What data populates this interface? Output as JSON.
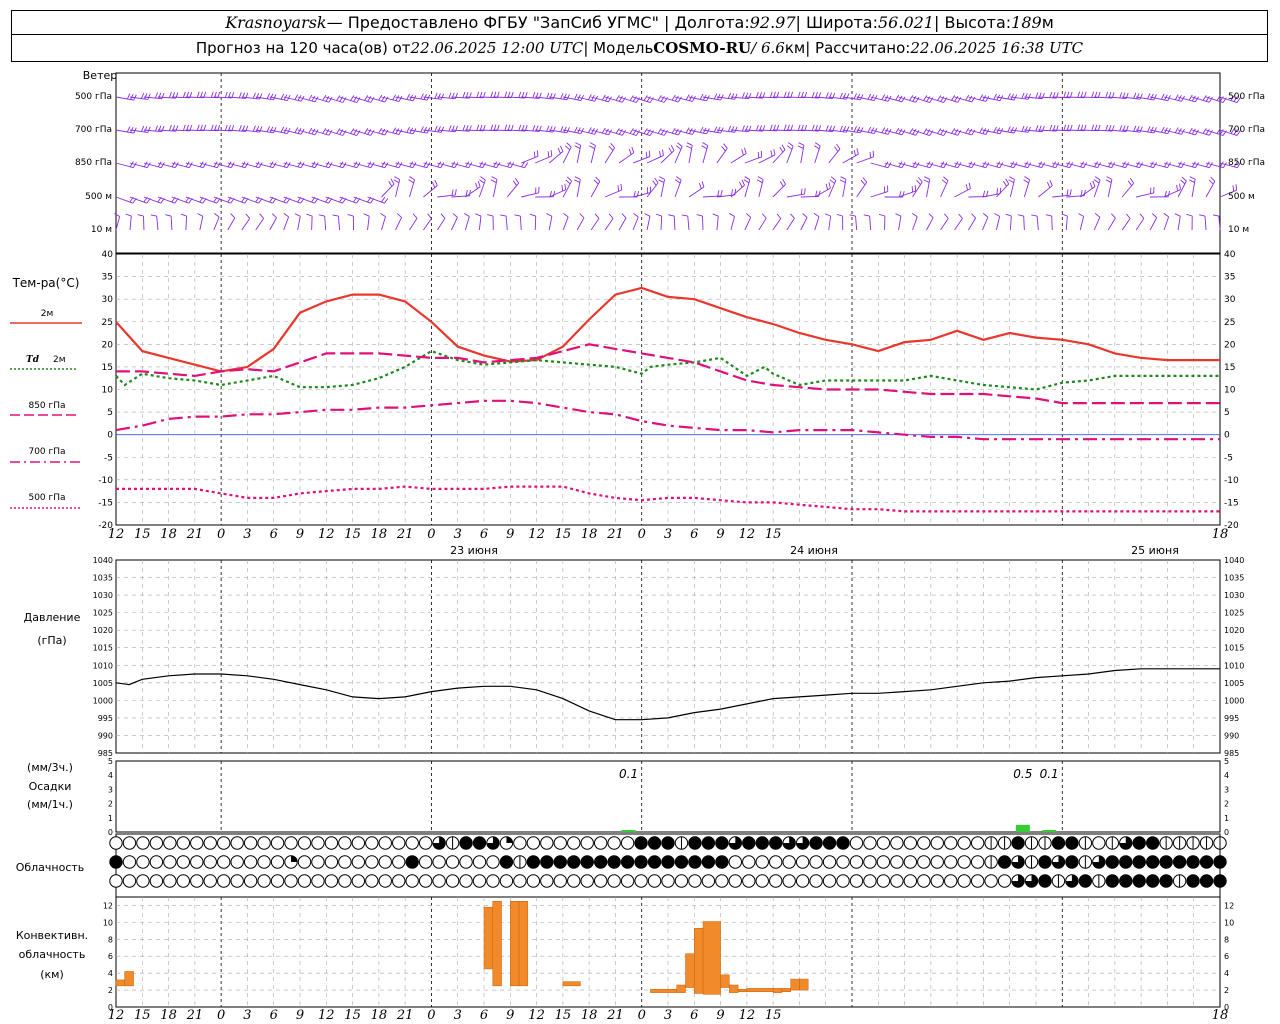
{
  "header": {
    "station": "Krasnoyarsk",
    "provider": " — Предоставлено ФГБУ \"ЗапСиб УГМС\" | Долгота: ",
    "lon": "92.97",
    "lat_label": " | Широта: ",
    "lat": "56.021",
    "alt_label": " | Высота: ",
    "alt": "189",
    "alt_unit": "м",
    "forecast_label": "Прогноз на 120 часа(ов) от ",
    "forecast_start": "22.06.2025 12:00 UTC",
    "model_label": " | Модель ",
    "model": "COSMO-RU",
    "resolution": " / 6.6",
    "res_unit": "км",
    "calc_label": " | Рассчитано: ",
    "calc_time": "22.06.2025 16:38 UTC"
  },
  "labels": {
    "wind_title": "Ветер",
    "wind_levels": [
      "500 гПа",
      "700 гПа",
      "850 гПа",
      "500 м",
      "10 м"
    ],
    "temp_title": "Тем-ра(°С)",
    "legend_2m": "2м",
    "legend_td": "Td",
    "legend_td_2m": "2м",
    "legend_850": "850 гПа",
    "legend_700": "700 гПа",
    "legend_500": "500 гПа",
    "pressure_title": "Давление",
    "pressure_unit": "(гПа)",
    "precip_unit3": "(мм/3ч.)",
    "precip_title": "Осадки",
    "precip_unit1": "(мм/1ч.)",
    "cloud_title": "Облачность",
    "conv_title1": "Конвективн.",
    "conv_title2": "облачность",
    "conv_unit": "(км)",
    "day1": "23 июня",
    "day2": "24 июня",
    "day3": "25 июня",
    "hour_ticks": [
      "12",
      "15",
      "18",
      "21",
      "0",
      "3",
      "6",
      "9",
      "12",
      "15",
      "18",
      "21",
      "0",
      "3",
      "6",
      "9",
      "12",
      "15",
      "18",
      "21",
      "0",
      "3",
      "6",
      "9",
      "12",
      "15",
      "18"
    ]
  },
  "chart_data": [
    {
      "type": "line",
      "title": "Тем-ра(°С)",
      "x_unit": "hours since 22.06 12 UTC",
      "ylim": [
        -20,
        40
      ],
      "series": [
        {
          "name": "2м",
          "color": "#e8382e",
          "style": "solid",
          "x": [
            0,
            3,
            6,
            9,
            12,
            15,
            18,
            21,
            24,
            27,
            30,
            33,
            36,
            39,
            42,
            45,
            48,
            51,
            54,
            57,
            60,
            63,
            66,
            69,
            72,
            75,
            78,
            81,
            84,
            87,
            90,
            93,
            96,
            99,
            102,
            105,
            108,
            111,
            114,
            117,
            120,
            123,
            126
          ],
          "values": [
            25,
            18.5,
            17,
            15.5,
            14,
            15,
            19,
            27,
            29.5,
            31,
            31,
            29.5,
            25,
            19.5,
            17.5,
            16.2,
            16.5,
            19.5,
            25.5,
            31,
            32.5,
            30.5,
            30,
            28,
            26,
            24.5,
            22.5,
            21,
            20,
            18.5,
            20.5,
            21,
            23,
            21,
            22.5,
            21.5,
            21,
            20,
            18,
            17,
            16.5,
            16.5,
            16.5
          ]
        },
        {
          "name": "Td 2м",
          "color": "#1e8a1e",
          "style": "dotted",
          "x": [
            0,
            1,
            3,
            6,
            9,
            12,
            15,
            18,
            21,
            24,
            27,
            30,
            33,
            36,
            39,
            42,
            45,
            48,
            51,
            54,
            57,
            60,
            61,
            63,
            66,
            69,
            72,
            74,
            75,
            78,
            81,
            84,
            87,
            90,
            93,
            96,
            99,
            102,
            105,
            108,
            111,
            114,
            117,
            120,
            123,
            126
          ],
          "values": [
            13,
            11,
            13.5,
            12.5,
            12,
            11,
            12,
            13,
            10.5,
            10.5,
            11,
            12.5,
            15,
            18.5,
            16.5,
            15.5,
            16,
            16.5,
            16,
            15.5,
            15,
            13.5,
            15,
            15.5,
            16,
            17,
            13,
            15,
            13.5,
            11,
            12,
            12,
            12,
            12,
            13,
            12,
            11,
            10.5,
            10,
            11.5,
            12,
            13,
            13,
            13,
            13,
            13
          ]
        },
        {
          "name": "850 гПа",
          "color": "#e0107a",
          "style": "dashed",
          "x": [
            0,
            3,
            6,
            9,
            12,
            15,
            18,
            21,
            24,
            27,
            30,
            33,
            36,
            39,
            42,
            45,
            48,
            51,
            54,
            57,
            60,
            63,
            66,
            69,
            72,
            75,
            78,
            81,
            84,
            87,
            90,
            93,
            96,
            99,
            102,
            105,
            108,
            111,
            114,
            117,
            120,
            123,
            126
          ],
          "values": [
            14,
            14,
            13.5,
            13,
            14,
            14.5,
            14,
            16,
            18,
            18,
            18,
            17.5,
            17,
            17,
            16,
            16.5,
            17,
            18.5,
            20,
            19,
            18,
            17,
            16,
            14,
            12,
            11,
            10.5,
            10,
            10,
            10,
            9.5,
            9,
            9,
            9,
            8.5,
            8,
            7,
            7,
            7,
            7,
            7,
            7,
            7
          ]
        },
        {
          "name": "700 гПа",
          "color": "#e0107a",
          "style": "dashdot",
          "x": [
            0,
            3,
            6,
            9,
            12,
            15,
            18,
            21,
            24,
            27,
            30,
            33,
            36,
            39,
            42,
            45,
            48,
            51,
            54,
            57,
            60,
            63,
            66,
            69,
            72,
            75,
            78,
            81,
            84,
            87,
            90,
            93,
            96,
            99,
            102,
            105,
            108,
            111,
            114,
            117,
            120,
            123,
            126
          ],
          "values": [
            1,
            2,
            3.5,
            4,
            4,
            4.5,
            4.5,
            5,
            5.5,
            5.5,
            6,
            6,
            6.5,
            7,
            7.5,
            7.5,
            7,
            6,
            5,
            4.5,
            3,
            2,
            1.5,
            1,
            1,
            0.5,
            1,
            1,
            1,
            0.5,
            0,
            -0.5,
            -0.5,
            -1,
            -1,
            -1,
            -1,
            -1,
            -1,
            -1,
            -1,
            -1,
            -1
          ]
        },
        {
          "name": "500 гПа",
          "color": "#e0107a",
          "style": "dotted",
          "x": [
            0,
            3,
            6,
            9,
            12,
            15,
            18,
            21,
            24,
            27,
            30,
            33,
            36,
            39,
            42,
            45,
            48,
            51,
            54,
            57,
            60,
            63,
            66,
            69,
            72,
            75,
            78,
            81,
            84,
            87,
            90,
            93,
            96,
            99,
            102,
            105,
            108,
            111,
            114,
            117,
            120,
            123,
            126
          ],
          "values": [
            -12,
            -12,
            -12,
            -12,
            -13,
            -14,
            -14,
            -13,
            -12.5,
            -12,
            -12,
            -11.5,
            -12,
            -12,
            -12,
            -11.5,
            -11.5,
            -11.5,
            -13,
            -14,
            -14.5,
            -14,
            -14,
            -14.5,
            -15,
            -15,
            -15.5,
            -16,
            -16.5,
            -16.5,
            -17,
            -17,
            -17,
            -17,
            -17,
            -17,
            -17,
            -17,
            -17,
            -17,
            -17,
            -17,
            -17
          ]
        }
      ]
    },
    {
      "type": "line",
      "title": "Давление",
      "ylabel": "(гПа)",
      "ylim": [
        985,
        1040
      ],
      "series": [
        {
          "name": "Давление",
          "color": "#000000",
          "x": [
            0,
            1.5,
            3,
            6,
            9,
            12,
            15,
            18,
            21,
            24,
            27,
            30,
            33,
            36,
            39,
            42,
            45,
            48,
            51,
            54,
            57,
            60,
            63,
            66,
            69,
            72,
            75,
            78,
            81,
            84,
            87,
            90,
            93,
            96,
            99,
            102,
            105,
            108,
            111,
            114,
            117,
            120,
            123,
            126
          ],
          "values": [
            1005,
            1004.5,
            1006,
            1007,
            1007.5,
            1007.5,
            1007,
            1006,
            1004.5,
            1003,
            1001,
            1000.5,
            1001,
            1002.5,
            1003.5,
            1004,
            1004,
            1003,
            1000.5,
            997,
            994.5,
            994.5,
            995,
            996.5,
            997.5,
            999,
            1000.5,
            1001,
            1001.5,
            1002,
            1002,
            1002.5,
            1003,
            1004,
            1005,
            1005.5,
            1006.5,
            1007,
            1007.5,
            1008.5,
            1009,
            1009,
            1009,
            1009
          ]
        }
      ]
    },
    {
      "type": "bar",
      "title": "Осадки",
      "ylim": [
        0,
        5
      ],
      "bars": [
        {
          "x": 58.5,
          "value": 0.1,
          "label": "0.1"
        },
        {
          "x": 103.5,
          "value": 0.5,
          "label": "0.5"
        },
        {
          "x": 106.5,
          "value": 0.1,
          "label": "0.1"
        }
      ]
    },
    {
      "type": "bar",
      "title": "Конвективн. облачность (км)",
      "ylim": [
        0,
        13
      ],
      "bars": [
        {
          "x0": 0,
          "x1": 1,
          "low": 2.5,
          "high": 3.2
        },
        {
          "x0": 1,
          "x1": 2,
          "low": 2.5,
          "high": 4.2
        },
        {
          "x0": 42,
          "x1": 43,
          "low": 4.5,
          "high": 11.8
        },
        {
          "x0": 43,
          "x1": 44,
          "low": 2.5,
          "high": 12.5
        },
        {
          "x0": 45,
          "x1": 46,
          "low": 2.5,
          "high": 12.5
        },
        {
          "x0": 46,
          "x1": 47,
          "low": 2.5,
          "high": 12.5
        },
        {
          "x0": 51,
          "x1": 53,
          "low": 2.5,
          "high": 3.0
        },
        {
          "x0": 61,
          "x1": 64,
          "low": 1.7,
          "high": 2.1
        },
        {
          "x0": 64,
          "x1": 65,
          "low": 1.7,
          "high": 2.6
        },
        {
          "x0": 65,
          "x1": 66,
          "low": 2.3,
          "high": 6.3
        },
        {
          "x0": 66,
          "x1": 67,
          "low": 1.6,
          "high": 9.3
        },
        {
          "x0": 67,
          "x1": 69,
          "low": 1.5,
          "high": 10.1
        },
        {
          "x0": 69,
          "x1": 70,
          "low": 2.3,
          "high": 3.8
        },
        {
          "x0": 70,
          "x1": 71,
          "low": 1.7,
          "high": 2.6
        },
        {
          "x0": 71,
          "x1": 72,
          "low": 1.8,
          "high": 2.1
        },
        {
          "x0": 72,
          "x1": 75,
          "low": 1.8,
          "high": 2.2
        },
        {
          "x0": 75,
          "x1": 76,
          "low": 1.7,
          "high": 2.2
        },
        {
          "x0": 76,
          "x1": 77,
          "low": 1.8,
          "high": 2.2
        },
        {
          "x0": 77,
          "x1": 78,
          "low": 2.0,
          "high": 3.3
        },
        {
          "x0": 78,
          "x1": 79,
          "low": 2.0,
          "high": 3.3
        }
      ]
    }
  ]
}
